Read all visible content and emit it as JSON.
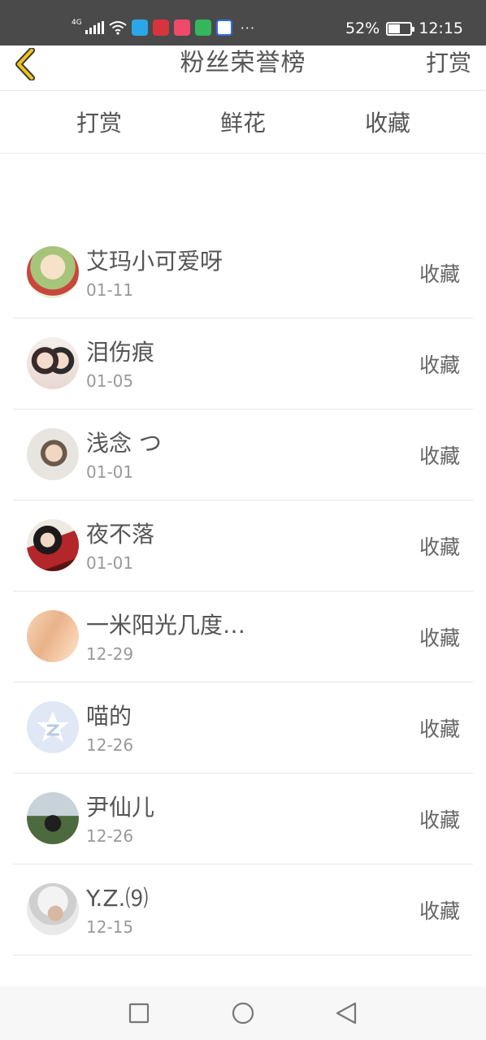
{
  "status_bar": {
    "network": "4G",
    "battery": "52%",
    "battery_level": 0.52,
    "time": "12:15",
    "more": "···",
    "icons": [
      "signal-icon",
      "wifi-icon",
      "app-icon-browser",
      "app-icon-reader",
      "app-icon-pink",
      "app-icon-video",
      "app-icon-baidu"
    ]
  },
  "header": {
    "title": "粉丝荣誉榜",
    "action": "打赏"
  },
  "tabs": [
    {
      "label": "打赏",
      "active": false
    },
    {
      "label": "鲜花",
      "active": false
    },
    {
      "label": "收藏",
      "active": true
    }
  ],
  "colors": {
    "accent": "#f2a51c",
    "back_icon": "#f0c419",
    "statusbar": "#4a4a4a"
  },
  "fans": [
    {
      "name": "艾玛小可爱呀",
      "date": "01-11",
      "action": "收藏",
      "avatar": "avatar-anime-girl"
    },
    {
      "name": "泪伤痕",
      "date": "01-05",
      "action": "收藏",
      "avatar": "avatar-anime-couple"
    },
    {
      "name": "浅念 つ",
      "date": "01-01",
      "action": "收藏",
      "avatar": "avatar-glasses-boy"
    },
    {
      "name": "夜不落",
      "date": "01-01",
      "action": "收藏",
      "avatar": "avatar-anime-red"
    },
    {
      "name": "一米阳光几度…",
      "date": "12-29",
      "action": "收藏",
      "avatar": "avatar-blonde-blur"
    },
    {
      "name": "喵的",
      "date": "12-26",
      "action": "收藏",
      "avatar": "avatar-qq-default"
    },
    {
      "name": "尹仙儿",
      "date": "12-26",
      "action": "收藏",
      "avatar": "avatar-landscape"
    },
    {
      "name": "Y.Z.⑼",
      "date": "12-15",
      "action": "收藏",
      "avatar": "avatar-white-hair"
    }
  ],
  "navbar": [
    "recents-icon",
    "home-icon",
    "back-triangle-icon"
  ]
}
